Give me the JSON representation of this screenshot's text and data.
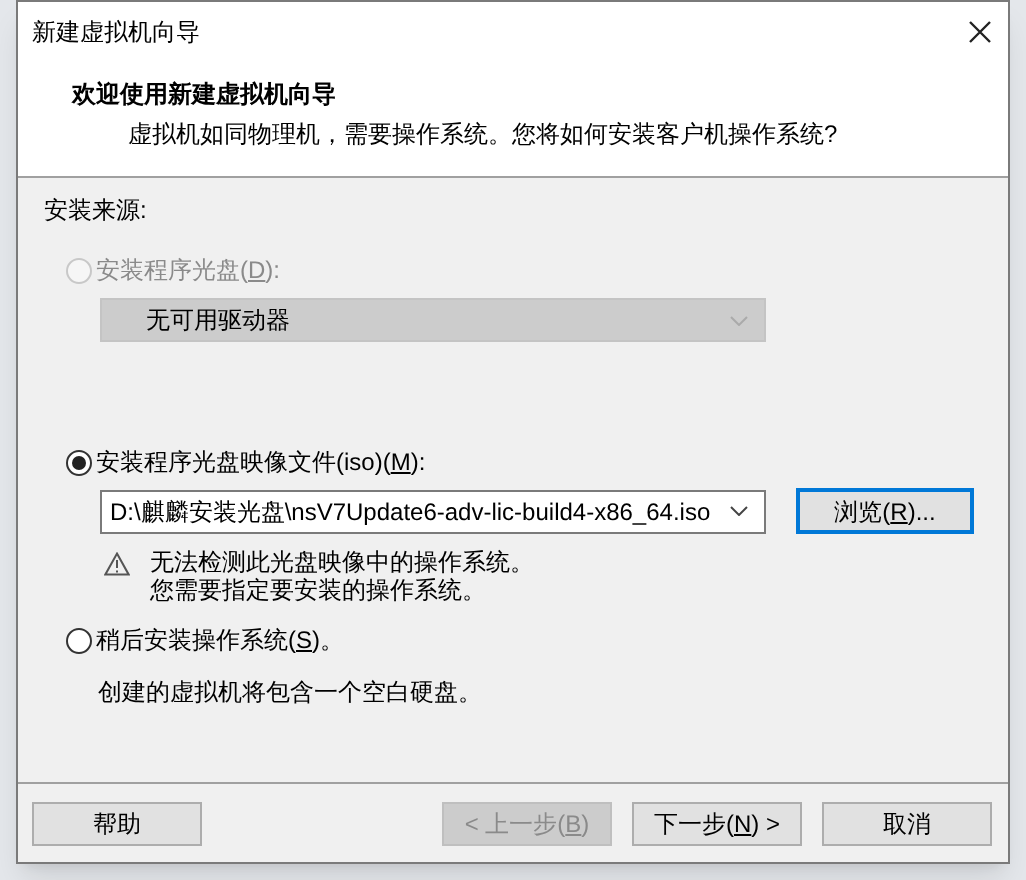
{
  "window": {
    "title": "新建虚拟机向导"
  },
  "header": {
    "title": "欢迎使用新建虚拟机向导",
    "subtitle": "虚拟机如同物理机，需要操作系统。您将如何安装客户机操作系统?"
  },
  "section_label": "安装来源:",
  "options": [
    {
      "kind": "disc",
      "before": "安装程序光盘(",
      "key": "D",
      "after": "):",
      "selected": false,
      "disabled": true,
      "dropdown": {
        "value": "无可用驱动器",
        "disabled": true
      }
    },
    {
      "kind": "iso",
      "before": "安装程序光盘映像文件(iso)(",
      "key": "M",
      "after": "):",
      "selected": true,
      "disabled": false,
      "combo": {
        "value": "D:\\麒麟安装光盘\\nsV7Update6-adv-lic-build4-x86_64.iso"
      },
      "browse": {
        "before": "浏览(",
        "key": "R",
        "after": ")...",
        "focused": true
      },
      "warning": [
        "无法检测此光盘映像中的操作系统。",
        "您需要指定要安装的操作系统。"
      ]
    },
    {
      "kind": "later",
      "before": "稍后安装操作系统(",
      "key": "S",
      "after": ")。",
      "selected": false,
      "disabled": false,
      "note": "创建的虚拟机将包含一个空白硬盘。"
    }
  ],
  "buttons": [
    {
      "before": "帮助",
      "disabled": false
    },
    {
      "before": "< 上一步(",
      "key": "B",
      "after": ")",
      "disabled": true
    },
    {
      "before": "下一步(",
      "key": "N",
      "after": ") >",
      "disabled": false
    },
    {
      "before": "取消",
      "disabled": false
    }
  ]
}
